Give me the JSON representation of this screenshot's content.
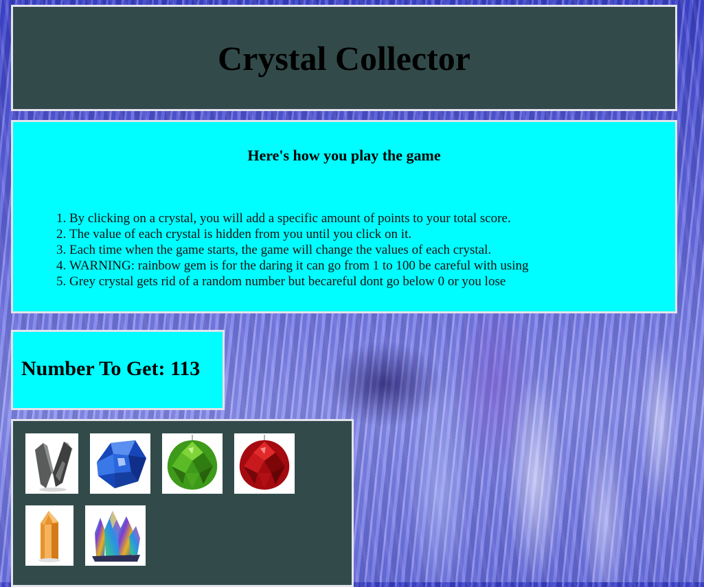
{
  "title": "Crystal Collector",
  "instructions": {
    "heading": "Here's how you play the game",
    "rules": [
      "By clicking on a crystal, you will add a specific amount of points to your total score.",
      "The value of each crystal is hidden from you until you click on it.",
      "Each time when the game starts, the game will change the values of each crystal.",
      "WARNING: rainbow gem is for the daring it can go from 1 to 100 be careful with using",
      "Grey crystal gets rid of a random number but becareful dont go below 0 or you lose"
    ]
  },
  "target": {
    "label": "Number To Get: 113"
  },
  "crystals": [
    {
      "name": "grey-crystal",
      "icon": "grey-crystal-icon"
    },
    {
      "name": "blue-crystal",
      "icon": "blue-crystal-icon"
    },
    {
      "name": "green-crystal",
      "icon": "green-crystal-icon"
    },
    {
      "name": "red-crystal",
      "icon": "red-crystal-icon"
    },
    {
      "name": "orange-crystal",
      "icon": "orange-crystal-icon"
    },
    {
      "name": "rainbow-crystal",
      "icon": "rainbow-crystal-icon"
    }
  ],
  "colors": {
    "dark_panel": "#324b4a",
    "cyan_panel": "#00fdff",
    "panel_border": "#e3e3ec"
  }
}
